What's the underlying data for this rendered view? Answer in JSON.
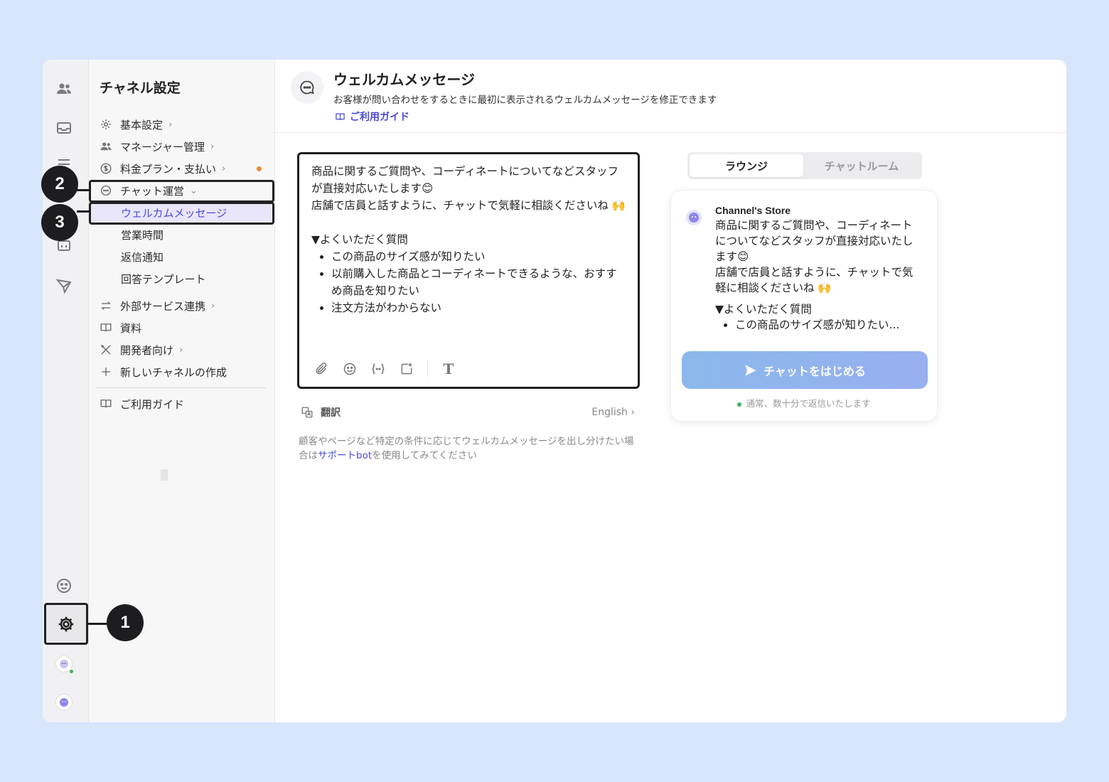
{
  "sidebar": {
    "title": "チャネル設定",
    "items": {
      "basic": "基本設定",
      "managers": "マネージャー管理",
      "billing": "料金プラン・支払い",
      "chat_ops": "チャット運営",
      "welcome": "ウェルカムメッセージ",
      "hours": "営業時間",
      "reply_notify": "返信通知",
      "templates": "回答テンプレート",
      "integrations": "外部サービス連携",
      "resources": "資料",
      "developers": "開発者向け",
      "new_channel": "新しいチャネルの作成",
      "guide": "ご利用ガイド"
    }
  },
  "header": {
    "title": "ウェルカムメッセージ",
    "description": "お客様が問い合わせをするときに最初に表示されるウェルカムメッセージを修正できます",
    "guide_link": "ご利用ガイド"
  },
  "editor": {
    "line1": "商品に関するご質問や、コーディネートについてなどスタッフが直接対応いたします😊",
    "line2": "店舗で店員と話すように、チャットで気軽に相談くださいね 🙌",
    "faq_heading": "▼よくいただく質問",
    "faq": [
      "この商品のサイズ感が知りたい",
      "以前購入した商品とコーディネートできるような、おすすめ商品を知りたい",
      "注文方法がわからない"
    ]
  },
  "translation": {
    "label": "翻訳",
    "language": "English"
  },
  "hint": {
    "before": "顧客やページなど特定の条件に応じてウェルカムメッセージを出し分けたい場合は",
    "link": "サポートbot",
    "after": "を使用してみてください"
  },
  "preview": {
    "tabs": [
      "ラウンジ",
      "チャットルーム"
    ],
    "store_name": "Channel's Store",
    "line1": "商品に関するご質問や、コーディネートについてなどスタッフが直接対応いたします😊",
    "line2": "店舗で店員と話すように、チャットで気軽に相談くださいね 🙌",
    "faq_heading": "▼よくいただく質問",
    "faq_first": "この商品のサイズ感が知りたい...",
    "button": "チャットをはじめる",
    "status": "通常、数十分で返信いたします"
  },
  "callouts": [
    "1",
    "2",
    "3"
  ],
  "colors": {
    "background": "#d8e6fd",
    "accent": "#4b4bd8",
    "selected": "#e9e6fb",
    "online": "#3cb55a",
    "notice_dot": "#ef8a34"
  },
  "icons": [
    "people-icon",
    "inbox-icon",
    "list-icon",
    "calendar-icon",
    "send-icon",
    "support-icon",
    "gear-icon",
    "avatar-icon",
    "chat-bubble-icon",
    "book-icon"
  ]
}
